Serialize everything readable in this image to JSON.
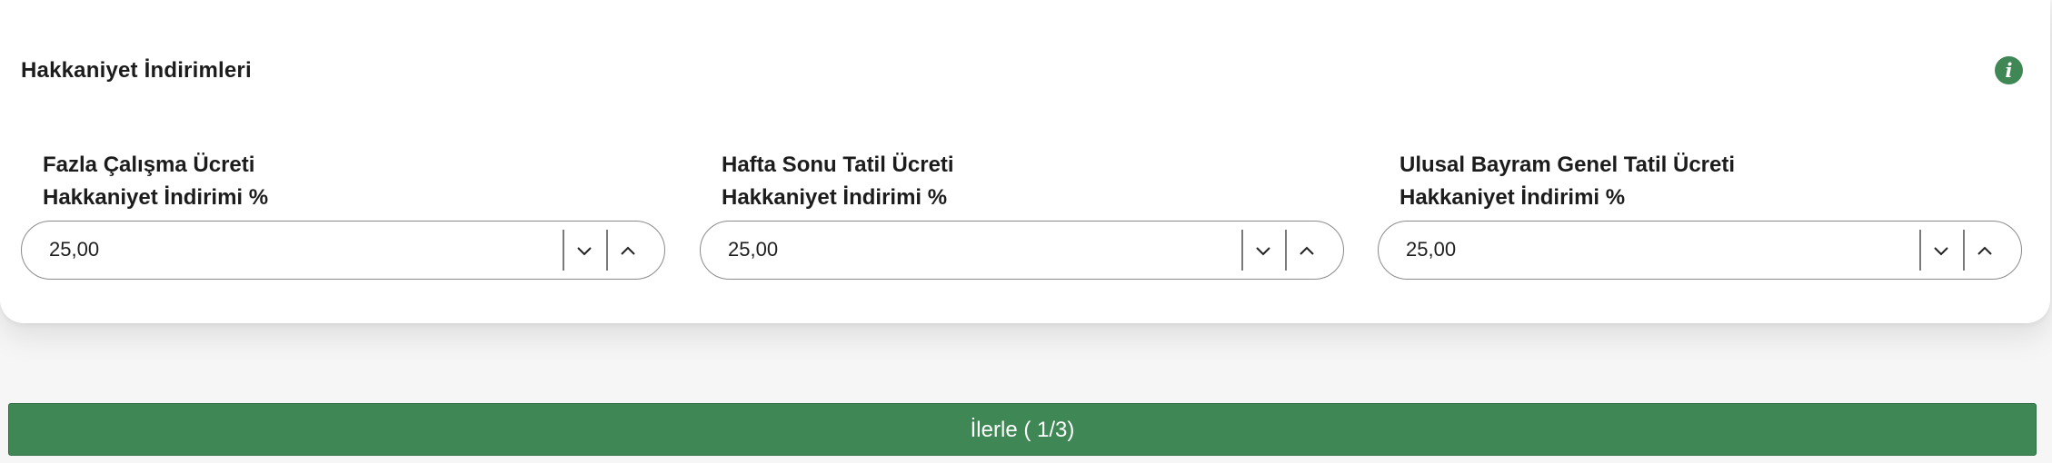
{
  "section": {
    "title": "Hakkaniyet İndirimleri",
    "info_icon": "info-icon",
    "accent_color": "#3f8755"
  },
  "fields": [
    {
      "label_line1": "Fazla Çalışma Ücreti",
      "label_line2": "Hakkaniyet İndirimi %",
      "value": "25,00"
    },
    {
      "label_line1": "Hafta Sonu Tatil Ücreti",
      "label_line2": "Hakkaniyet İndirimi %",
      "value": "25,00"
    },
    {
      "label_line1": "Ulusal Bayram Genel Tatil Ücreti",
      "label_line2": "Hakkaniyet İndirimi %",
      "value": "25,00"
    }
  ],
  "icons": {
    "decrement": "chevron-down-icon",
    "increment": "chevron-up-icon"
  },
  "next_button": {
    "label": "İlerle ( 1/3)"
  }
}
